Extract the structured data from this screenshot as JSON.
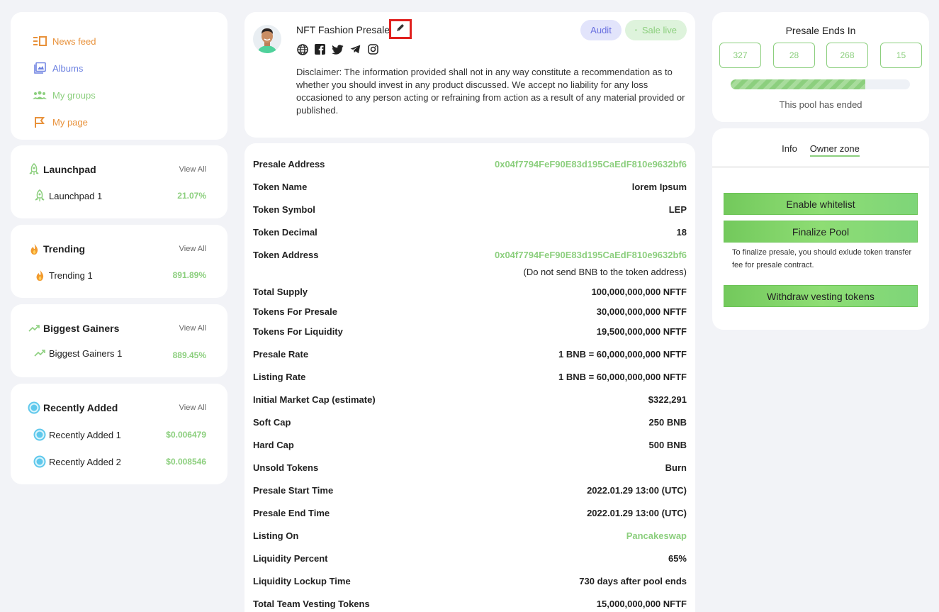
{
  "nav": {
    "items": [
      {
        "label": "News feed",
        "icon": "news-feed-icon",
        "color": "#e8913a"
      },
      {
        "label": "Albums",
        "icon": "albums-icon",
        "color": "#6a7fe0"
      },
      {
        "label": "My groups",
        "icon": "groups-icon",
        "color": "#8ccf7e"
      },
      {
        "label": "My page",
        "icon": "flag-icon",
        "color": "#e8913a"
      }
    ]
  },
  "widgets": {
    "launchpad": {
      "title": "Launchpad",
      "view_all": "View All",
      "rows": [
        {
          "name": "Launchpad 1",
          "value": "21.07%"
        }
      ]
    },
    "trending": {
      "title": "Trending",
      "view_all": "View All",
      "rows": [
        {
          "name": "Trending 1",
          "value": "891.89%"
        }
      ]
    },
    "gainers": {
      "title": "Biggest Gainers",
      "view_all": "View All",
      "rows": [
        {
          "name": "Biggest Gainers 1",
          "value": "889.45%"
        }
      ]
    },
    "recent": {
      "title": "Recently Added",
      "view_all": "View All",
      "rows": [
        {
          "name": "Recently Added 1",
          "value": "$0.006479"
        },
        {
          "name": "Recently Added 2",
          "value": "$0.008546"
        }
      ]
    }
  },
  "project": {
    "name": "NFT Fashion Presale",
    "badge_audit": "Audit",
    "badge_live": "Sale live",
    "socials": [
      "globe-icon",
      "facebook-icon",
      "twitter-icon",
      "telegram-icon",
      "instagram-icon"
    ],
    "disclaimer": "Disclaimer: The information provided shall not in any way constitute a recommendation as to whether you should invest in any product discussed. We accept no liability for any loss occasioned to any person acting or refraining from action as a result of any material provided or published."
  },
  "details": {
    "rows": [
      {
        "label": "Presale Address",
        "value": "0x04f7794FeF90E83d195CaEdF810e9632bf6"
      },
      {
        "label": "Token Name",
        "value": "lorem Ipsum"
      },
      {
        "label": "Token Symbol",
        "value": "LEP"
      },
      {
        "label": "Token Decimal",
        "value": "18"
      },
      {
        "label": "Token Address",
        "value": "0x04f7794FeF90E83d195CaEdF810e9632bf6"
      },
      {
        "label": "Total Supply",
        "value": "100,000,000,000 NFTF"
      },
      {
        "label": "Tokens For Presale",
        "value": "30,000,000,000 NFTF"
      },
      {
        "label": "Tokens For Liquidity",
        "value": "19,500,000,000 NFTF"
      },
      {
        "label": "Presale Rate",
        "value": "1 BNB = 60,000,000,000 NFTF"
      },
      {
        "label": "Listing Rate",
        "value": "1 BNB = 60,000,000,000 NFTF"
      },
      {
        "label": "Initial Market Cap (estimate)",
        "value": "$322,291"
      },
      {
        "label": "Soft Cap",
        "value": "250 BNB"
      },
      {
        "label": "Hard Cap",
        "value": "500 BNB"
      },
      {
        "label": "Unsold Tokens",
        "value": "Burn"
      },
      {
        "label": "Presale Start Time",
        "value": "2022.01.29 13:00 (UTC)"
      },
      {
        "label": "Presale End Time",
        "value": "2022.01.29 13:00 (UTC)"
      },
      {
        "label": "Listing On",
        "value": "Pancakeswap"
      },
      {
        "label": "Liquidity Percent",
        "value": "65%"
      },
      {
        "label": "Liquidity Lockup Time",
        "value": "730 days after pool ends"
      },
      {
        "label": "Total Team Vesting Tokens",
        "value": "15,000,000,000 NFTF"
      }
    ],
    "token_address_note": "(Do not send BNB to the token address)"
  },
  "timer": {
    "title": "Presale Ends In",
    "values": [
      "327",
      "28",
      "268",
      "15"
    ],
    "progress": 0.75,
    "status": "This pool has ended"
  },
  "owner": {
    "tab_info": "Info",
    "tab_owner": "Owner zone",
    "enable_whitelist": "Enable whitelist",
    "finalize_pool": "Finalize Pool",
    "finalize_note": "To finalize presale, you should exlude token transfer fee for presale contract.",
    "withdraw_vesting": "Withdraw vesting tokens"
  },
  "colors": {
    "accent_green": "#8ccf7e",
    "accent_orange": "#e8913a",
    "accent_blue": "#6a7fe0",
    "highlight_red": "#e0201e"
  }
}
